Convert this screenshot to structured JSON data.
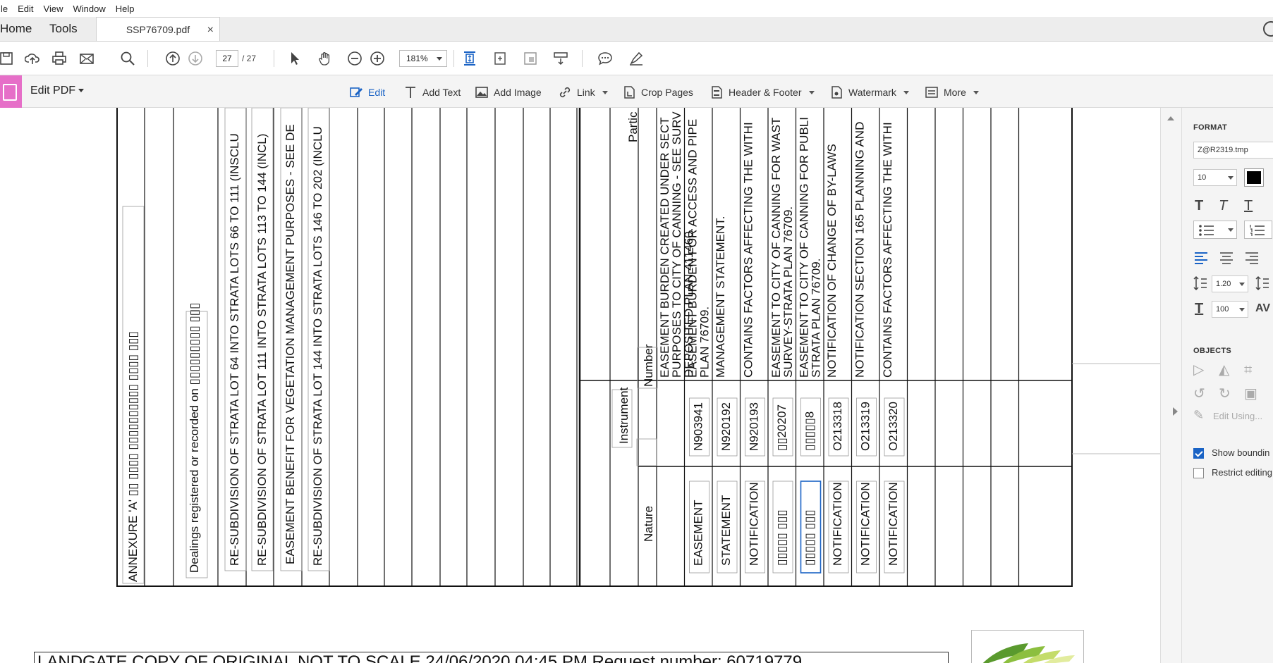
{
  "menu": [
    "le",
    "Edit",
    "View",
    "Window",
    "Help"
  ],
  "tabs": {
    "home": "Home",
    "tools": "Tools",
    "document": "SSP76709.pdf",
    "close": "×"
  },
  "toolbar": {
    "page_current": "27",
    "page_total": "/  27",
    "zoom": "181%"
  },
  "edit_bar": {
    "title": "Edit PDF",
    "tools": [
      "Edit",
      "Add Text",
      "Add Image",
      "Link",
      "Crop Pages",
      "Header & Footer",
      "Watermark",
      "More"
    ]
  },
  "panel": {
    "format_heading": "FORMAT",
    "font_name": "Z@R2319.tmp",
    "font_size": "10",
    "line_spacing": "1.20",
    "scale": "100",
    "objects_heading": "OBJECTS",
    "edit_using": "Edit Using...",
    "show_bounding": "Show boundin",
    "restrict_editing": "Restrict editing"
  },
  "document": {
    "left_column_texts": [
      "ANNEXURE 'A'  ▯▯ ▯▯▯▯ ▯▯▯▯▯▯▯▯▯▯ ▯▯▯▯ ▯▯▯",
      "Dealings registered or recorded on ▯▯▯▯▯▯▯▯▯ ▯▯▯",
      "RE-SUBDIVISION OF STRATA LOT 64 INTO STRATA LOTS 66 TO 111 (INSCLU",
      "RE-SUBDIVISION OF STRATA LOT 111 INTO STRATA LOTS 113 TO 144 (INCL)",
      "EASEMENT BENEFIT FOR VEGETATION MANAGEMENT PURPOSES - SEE DE",
      "RE-SUBDIVISION OF STRATA LOT 144 INTO STRATA LOTS 146 TO 202 (INCLU"
    ],
    "header_particulars": "Partic",
    "header_instrument": "Instrument",
    "header_number": "Number",
    "header_nature": "Nature",
    "rows": [
      {
        "particulars": [
          "EASEMENT BURDEN CREATED UNDER SECT",
          "PURPOSES TO CITY OF CANNING - SEE SURV",
          "DEPOSITED PLAN 411460."
        ],
        "number": "",
        "nature": ""
      },
      {
        "particulars": [
          "EASEMENT BURDEN FOR ACCESS AND PIPE",
          "PLAN 76709."
        ],
        "number": "N903941",
        "nature": "EASEMENT"
      },
      {
        "particulars": [
          "MANAGEMENT STATEMENT."
        ],
        "number": "N920192",
        "nature": "STATEMENT"
      },
      {
        "particulars": [
          "CONTAINS FACTORS AFFECTING THE WITHI"
        ],
        "number": "N920193",
        "nature": "NOTIFICATION"
      },
      {
        "particulars": [
          "EASEMENT TO CITY OF CANNING FOR WAST",
          "SURVEY-STRATA PLAN 76709."
        ],
        "number": "▯▯20207",
        "nature": "▯▯▯▯▯ ▯▯▯"
      },
      {
        "particulars": [
          "EASEMENT TO CITY OF CANNING FOR PUBLI",
          "STRATA PLAN 76709."
        ],
        "number": "▯▯▯▯▯8",
        "nature": "▯▯▯▯▯ ▯▯▯"
      },
      {
        "particulars": [
          "NOTIFICATION OF CHANGE OF BY-LAWS"
        ],
        "number": "O213318",
        "nature": "NOTIFICATION"
      },
      {
        "particulars": [
          "NOTIFICATION SECTION 165 PLANNING AND"
        ],
        "number": "O213319",
        "nature": "NOTIFICATION"
      },
      {
        "particulars": [
          "CONTAINS FACTORS AFFECTING THE WITHI"
        ],
        "number": "O213320",
        "nature": "NOTIFICATION"
      }
    ],
    "footer": "LANDGATE COPY OF ORIGINAL NOT TO SCALE   24/06/2020 04:45 PM   Request number: 60719779"
  },
  "colors": {
    "accent": "#1a63c5",
    "edit_pdf_tool": "#e66fc8"
  }
}
